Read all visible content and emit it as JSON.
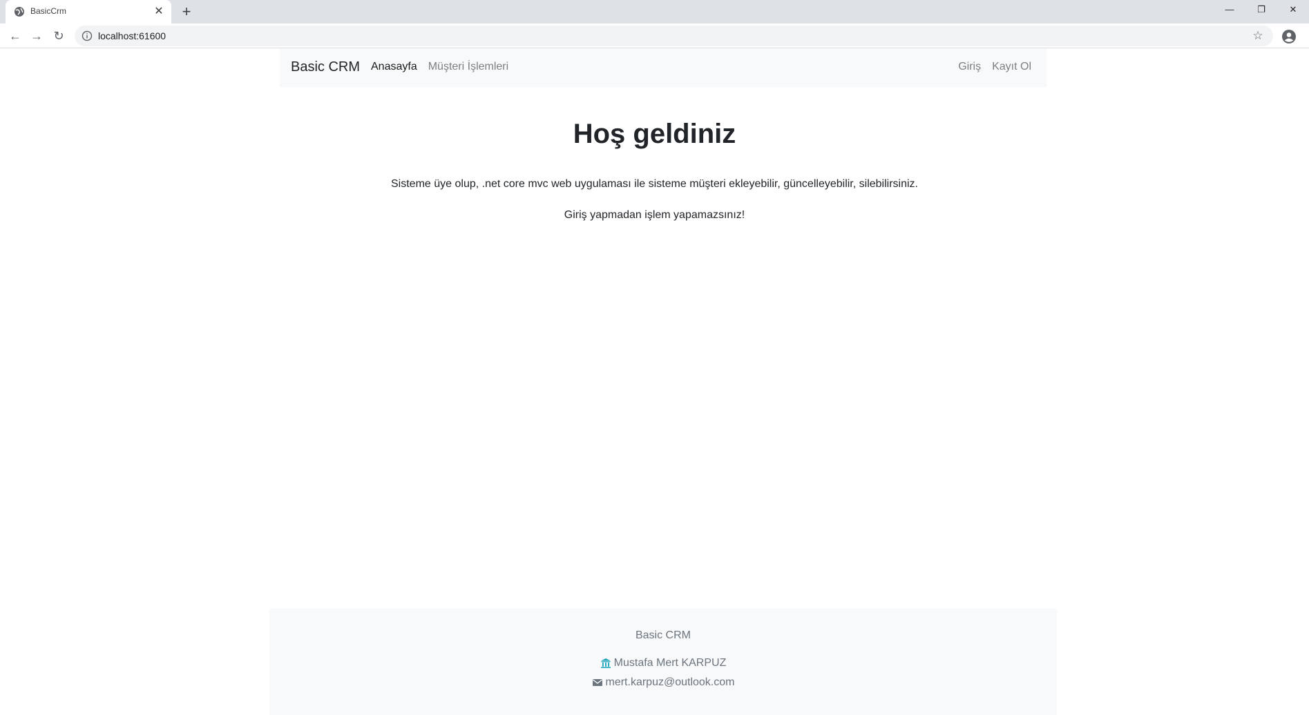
{
  "browser": {
    "tab_title": "BasicCrm",
    "new_tab_label": "+",
    "url": "localhost:61600"
  },
  "navbar": {
    "brand": "Basic CRM",
    "left_links": [
      "Anasayfa",
      "Müşteri İşlemleri"
    ],
    "right_links": [
      "Giriş",
      "Kayıt Ol"
    ]
  },
  "main": {
    "heading": "Hoş geldiniz",
    "paragraph1": "Sisteme üye olup, .net core mvc web uygulaması ile sisteme müşteri ekleyebilir, güncelleyebilir, silebilirsiniz.",
    "paragraph2": "Giriş yapmadan işlem yapamazsınız!"
  },
  "footer": {
    "brand": "Basic CRM",
    "author": "Mustafa Mert KARPUZ",
    "email": "mert.karpuz@outlook.com"
  },
  "colors": {
    "navbar_bg": "#f8f9fa",
    "footer_bg": "#f8f9fa",
    "author_icon": "#17a2b8"
  }
}
